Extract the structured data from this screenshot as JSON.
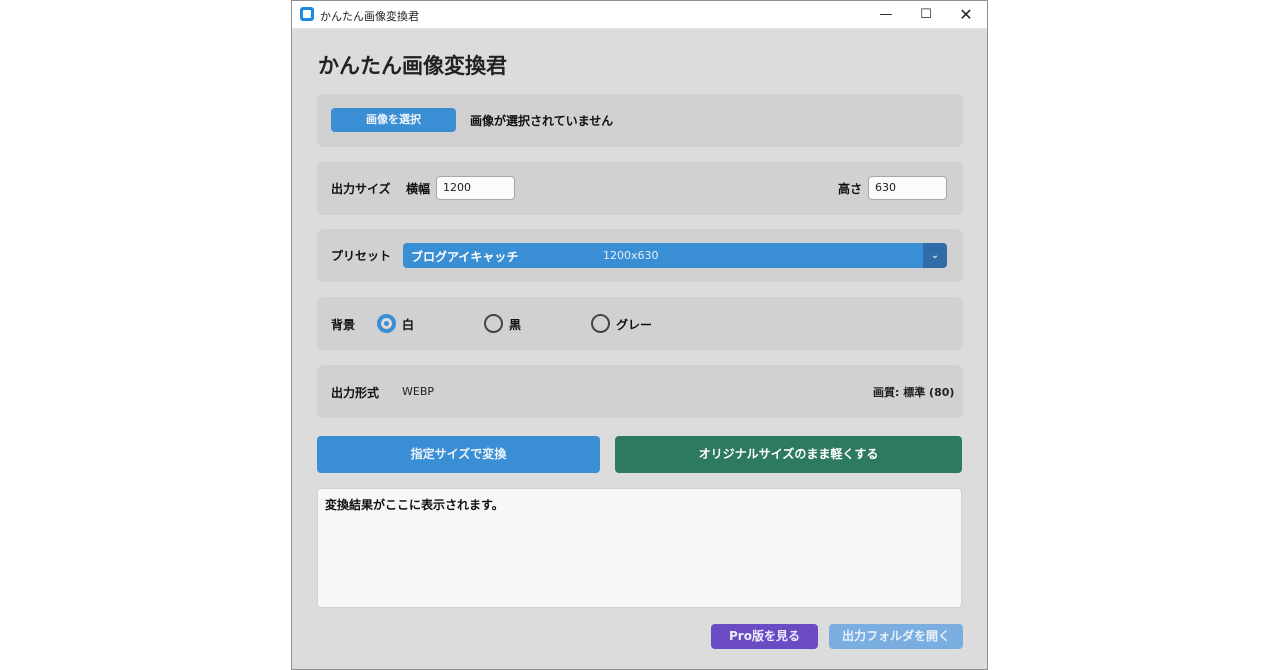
{
  "window": {
    "title": "かんたん画像変換君",
    "controls": {
      "minimize": "—",
      "maximize": "☐",
      "close": "✕"
    }
  },
  "app": {
    "heading": "かんたん画像変換君"
  },
  "file_select": {
    "button_label": "画像を選択",
    "status": "画像が選択されていません"
  },
  "output_size": {
    "label": "出力サイズ",
    "width_label": "横幅",
    "width_value": "1200",
    "height_label": "高さ",
    "height_value": "630"
  },
  "preset": {
    "label": "プリセット",
    "selected_name": "ブログアイキャッチ",
    "selected_size": "1200x630",
    "arrow": "⌄"
  },
  "background": {
    "label": "背景",
    "options": [
      {
        "label": "白",
        "selected": true
      },
      {
        "label": "黒",
        "selected": false
      },
      {
        "label": "グレー",
        "selected": false
      }
    ]
  },
  "format": {
    "label": "出力形式",
    "value": "WEBP",
    "quality_label": "画質: 標準 (80)"
  },
  "actions": {
    "convert_label": "指定サイズで変換",
    "compress_label": "オリジナルサイズのまま軽くする"
  },
  "result": {
    "text": "変換結果がここに表示されます。"
  },
  "footer": {
    "pro_label": "Pro版を見る",
    "open_folder_label": "出力フォルダを開く"
  },
  "colors": {
    "primary": "#3a8ed4",
    "green": "#2e7a5e",
    "purple": "#6a4bc4",
    "panel": "#d1d1d1",
    "background": "#dcdcdc"
  }
}
